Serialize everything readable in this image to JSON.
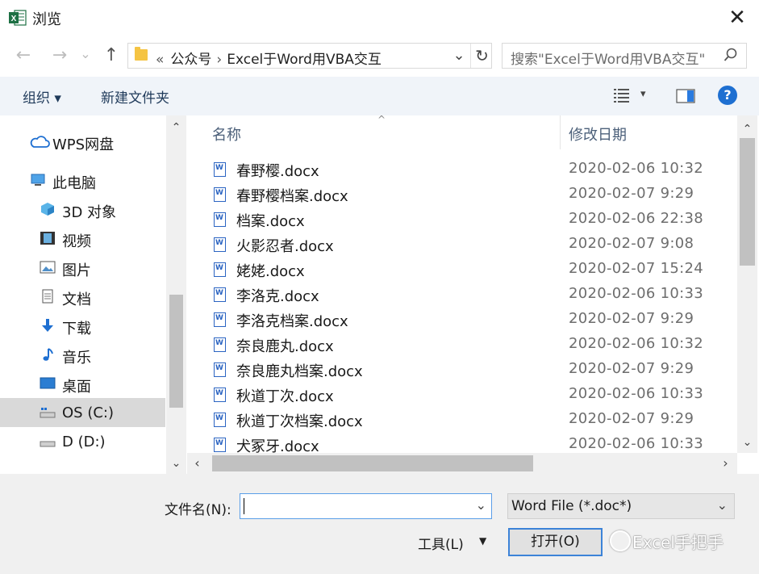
{
  "window": {
    "title": "浏览",
    "app_icon": "excel-icon",
    "close": "✕"
  },
  "nav": {
    "back": "←",
    "forward": "→",
    "recent": "⌄",
    "up": "↑",
    "address": {
      "prefix": "«",
      "crumbs": [
        "公众号",
        "Excel于Word用VBA交互"
      ],
      "separator": "›"
    },
    "search_placeholder": "搜索\"Excel于Word用VBA交互\"",
    "refresh_icon": "↻",
    "search_icon": "⚲"
  },
  "toolbar": {
    "organize": "组织 ▾",
    "new_folder": "新建文件夹",
    "view_menu": "▾",
    "help": "?"
  },
  "sidebar": {
    "items": [
      {
        "label": "WPS网盘",
        "icon": "cloud-icon"
      },
      {
        "label": "此电脑",
        "icon": "computer-icon"
      },
      {
        "label": "3D 对象",
        "icon": "cube-icon"
      },
      {
        "label": "视频",
        "icon": "film-icon"
      },
      {
        "label": "图片",
        "icon": "picture-icon"
      },
      {
        "label": "文档",
        "icon": "document-icon"
      },
      {
        "label": "下载",
        "icon": "download-icon"
      },
      {
        "label": "音乐",
        "icon": "music-icon"
      },
      {
        "label": "桌面",
        "icon": "desktop-icon"
      },
      {
        "label": "OS (C:)",
        "icon": "drive-icon",
        "selected": true
      },
      {
        "label": "D (D:)",
        "icon": "drive-icon"
      }
    ]
  },
  "file_list": {
    "columns": [
      "名称",
      "修改日期"
    ],
    "sort_indicator": "^",
    "rows": [
      {
        "name": "春野樱.docx",
        "date": "2020-02-06  10:32"
      },
      {
        "name": "春野樱档案.docx",
        "date": "2020-02-07  9:29"
      },
      {
        "name": "档案.docx",
        "date": "2020-02-06  22:38"
      },
      {
        "name": "火影忍者.docx",
        "date": "2020-02-07  9:08"
      },
      {
        "name": "姥姥.docx",
        "date": "2020-02-07  15:24"
      },
      {
        "name": "李洛克.docx",
        "date": "2020-02-06  10:33"
      },
      {
        "name": "李洛克档案.docx",
        "date": "2020-02-07  9:29"
      },
      {
        "name": "奈良鹿丸.docx",
        "date": "2020-02-06  10:32"
      },
      {
        "name": "奈良鹿丸档案.docx",
        "date": "2020-02-07  9:29"
      },
      {
        "name": "秋道丁次.docx",
        "date": "2020-02-06  10:33"
      },
      {
        "name": "秋道丁次档案.docx",
        "date": "2020-02-07  9:29"
      },
      {
        "name": "犬冢牙.docx",
        "date": "2020-02-06  10:33"
      }
    ]
  },
  "footer": {
    "filename_label": "文件名(N):",
    "filename_value": "",
    "filetype_value": "Word File (*.doc*)",
    "tools_label": "工具(L)",
    "tools_arrow": "▼",
    "open_label": "打开(O)",
    "watermark": "Excel手把手"
  },
  "colors": {
    "accent": "#1e6fd1",
    "toolbar_bg": "#f0f4f9",
    "selected_bg": "#d9d9d9"
  }
}
